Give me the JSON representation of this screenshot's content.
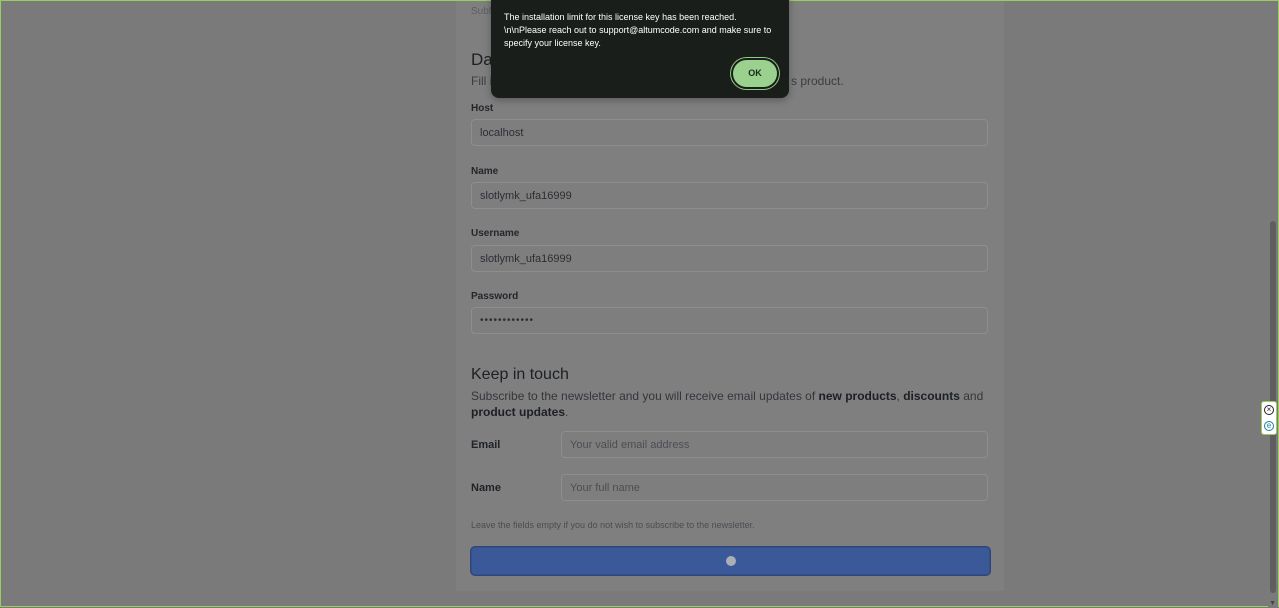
{
  "database": {
    "subtitle_fragment": "Subf",
    "title_fragment": "Da",
    "desc_fragment_left": "Fill i",
    "desc_fragment_right": "s product.",
    "fields": [
      {
        "label": "Host",
        "value": "localhost"
      },
      {
        "label": "Name",
        "value": "slotlymk_ufa16999"
      },
      {
        "label": "Username",
        "value": "slotlymk_ufa16999"
      },
      {
        "label": "Password",
        "value": "••••••••••••"
      }
    ]
  },
  "newsletter": {
    "title": "Keep in touch",
    "desc_parts": [
      "Subscribe to the newsletter and you will receive email updates of ",
      "new products",
      ", ",
      "discounts",
      " and ",
      "product updates",
      "."
    ],
    "email_label": "Email",
    "email_placeholder": "Your valid email address",
    "name_label": "Name",
    "name_placeholder": "Your full name",
    "hint": "Leave the fields empty if you do not wish to subscribe to the newsletter."
  },
  "dialog": {
    "message": "The installation limit for this license key has been reached. \\n\\nPlease reach out to support@altumcode.com and make sure to specify your license key.",
    "ok_label": "OK"
  },
  "colors": {
    "submit": "#3b5998",
    "ok_button": "#9ad18f",
    "dialog_bg": "#1a1e1a"
  },
  "icons": {
    "widget_close": "close-circle-icon",
    "widget_e": "e-circle-icon"
  }
}
